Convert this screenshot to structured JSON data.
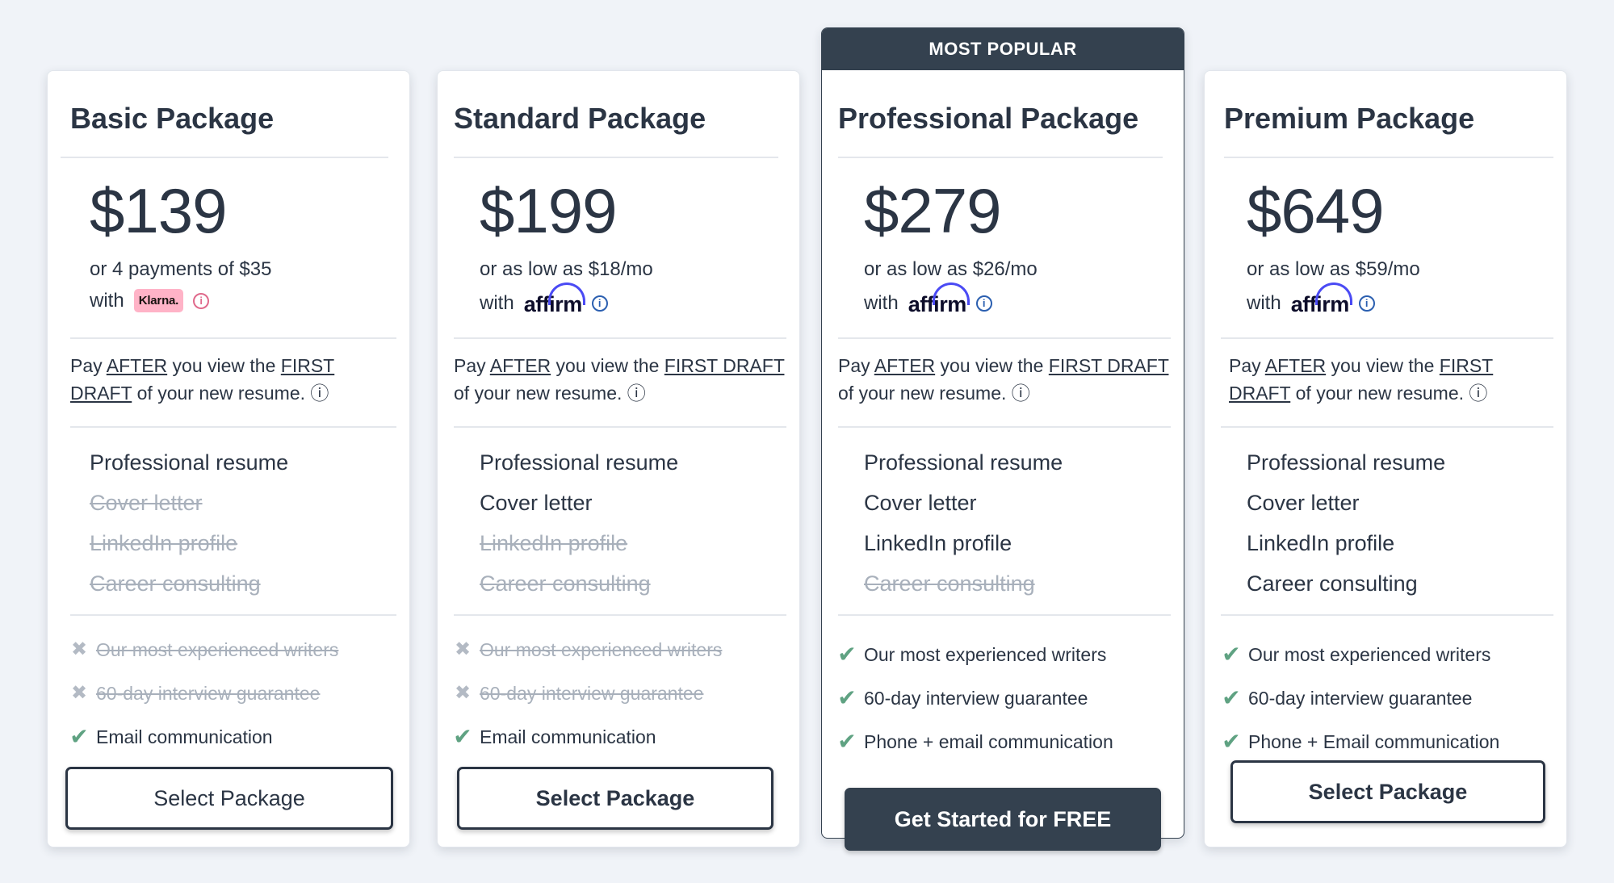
{
  "colors": {
    "page_bg": "#f0f3f8",
    "card_bg": "#ffffff",
    "primary_dark": "#34414f",
    "text": "#2b3544",
    "muted": "#a8b0bb",
    "check_green": "#5fa282",
    "klarna_pink": "#ffb3c7"
  },
  "featured_banner": "MOST POPULAR",
  "common": {
    "with": "with",
    "pay_note": {
      "pre": "Pay ",
      "after": "AFTER",
      "mid": " you view the ",
      "first_draft": "FIRST DRAFT",
      "post": " of your new resume. ⓘ"
    }
  },
  "plans": [
    {
      "title": "Basic Package",
      "price": "$139",
      "installment": "or 4 payments of $35",
      "provider": "Klarna.",
      "provider_icon": "klarna-badge",
      "features": [
        {
          "label": "Professional resume",
          "included": true
        },
        {
          "label": "Cover letter",
          "included": false
        },
        {
          "label": "LinkedIn profile",
          "included": false
        },
        {
          "label": "Career consulting",
          "included": false
        }
      ],
      "perks": [
        {
          "label": "Our most experienced writers",
          "included": false
        },
        {
          "label": "60-day interview guarantee",
          "included": false
        },
        {
          "label": "Email communication",
          "included": true
        }
      ],
      "cta": "Select Package"
    },
    {
      "title": "Standard Package",
      "price": "$199",
      "installment": "or as low as $18/mo",
      "provider": "affirm",
      "provider_icon": "affirm-logo",
      "features": [
        {
          "label": "Professional resume",
          "included": true
        },
        {
          "label": "Cover letter",
          "included": true
        },
        {
          "label": "LinkedIn profile",
          "included": false
        },
        {
          "label": "Career consulting",
          "included": false
        }
      ],
      "perks": [
        {
          "label": "Our most experienced writers",
          "included": false
        },
        {
          "label": "60-day interview guarantee",
          "included": false
        },
        {
          "label": "Email communication",
          "included": true
        }
      ],
      "cta": "Select Package"
    },
    {
      "title": "Professional Package",
      "price": "$279",
      "installment": "or as low as $26/mo",
      "provider": "affirm",
      "provider_icon": "affirm-logo",
      "features": [
        {
          "label": "Professional resume",
          "included": true
        },
        {
          "label": "Cover letter",
          "included": true
        },
        {
          "label": "LinkedIn profile",
          "included": true
        },
        {
          "label": "Career consulting",
          "included": false
        }
      ],
      "perks": [
        {
          "label": "Our most experienced writers",
          "included": true
        },
        {
          "label": "60-day interview guarantee",
          "included": true
        },
        {
          "label": "Phone + email communication",
          "included": true
        }
      ],
      "cta": "Get Started for FREE"
    },
    {
      "title": "Premium Package",
      "price": "$649",
      "installment": "or as low as $59/mo",
      "provider": "affirm",
      "provider_icon": "affirm-logo",
      "features": [
        {
          "label": "Professional resume",
          "included": true
        },
        {
          "label": "Cover letter",
          "included": true
        },
        {
          "label": "LinkedIn profile",
          "included": true
        },
        {
          "label": "Career consulting",
          "included": true
        }
      ],
      "perks": [
        {
          "label": "Our most experienced writers",
          "included": true
        },
        {
          "label": "60-day interview guarantee",
          "included": true
        },
        {
          "label": "Phone + Email communication",
          "included": true
        }
      ],
      "cta": "Select Package"
    }
  ]
}
